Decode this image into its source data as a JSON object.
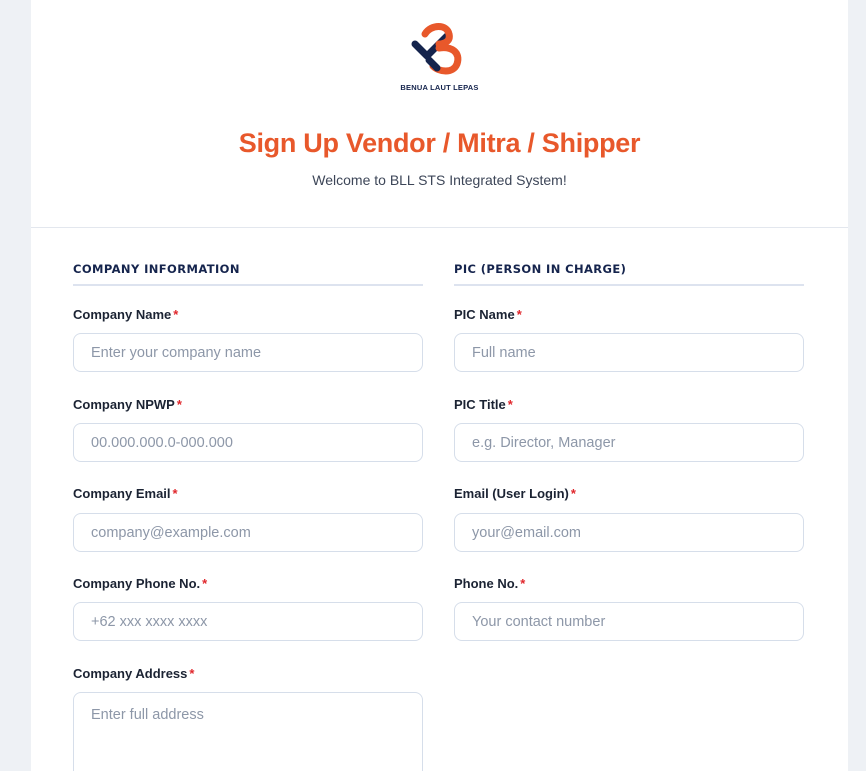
{
  "brand": {
    "name": "BENUA LAUT LEPAS",
    "colors": {
      "orange": "#e8582b",
      "navy": "#15244d"
    }
  },
  "header": {
    "title": "Sign Up Vendor / Mitra / Shipper",
    "subtitle": "Welcome to BLL STS Integrated System!"
  },
  "sections": {
    "company": "COMPANY INFORMATION",
    "pic": "PIC (PERSON IN CHARGE)"
  },
  "required_mark": "*",
  "company_fields": {
    "name": {
      "label": "Company Name",
      "placeholder": "Enter your company name"
    },
    "npwp": {
      "label": "Company NPWP",
      "placeholder": "00.000.000.0-000.000"
    },
    "email": {
      "label": "Company Email",
      "placeholder": "company@example.com"
    },
    "phone": {
      "label": "Company Phone No.",
      "placeholder": "+62 xxx xxxx xxxx"
    },
    "address": {
      "label": "Company Address",
      "placeholder": "Enter full address"
    }
  },
  "pic_fields": {
    "name": {
      "label": "PIC Name",
      "placeholder": "Full name"
    },
    "title": {
      "label": "PIC Title",
      "placeholder": "e.g. Director, Manager"
    },
    "email": {
      "label": "Email (User Login)",
      "placeholder": "your@email.com"
    },
    "phone": {
      "label": "Phone No.",
      "placeholder": "Your contact number"
    }
  }
}
